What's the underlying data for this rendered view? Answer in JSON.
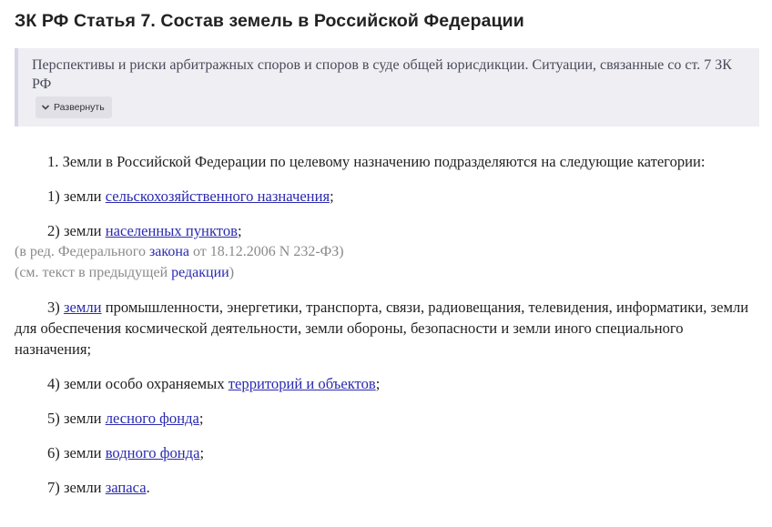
{
  "title": "ЗК РФ Статья 7. Состав земель в Российской Федерации",
  "related": {
    "text": "Перспективы и риски арбитражных споров и споров в суде общей юрисдикции. Ситуации, связанные со ст. 7 ЗК РФ",
    "expand_label": "Развернуть"
  },
  "article": {
    "intro": "1. Земли в Российской Федерации по целевому назначению подразделяются на следующие категории:",
    "item1_pre": "1) земли ",
    "item1_link": "сельскохозяйственного назначения",
    "item1_post": ";",
    "item2_pre": "2) земли ",
    "item2_link": "населенных пунктов",
    "item2_post": ";",
    "note1_pre": "(в ред. Федерального ",
    "note1_link": "закона",
    "note1_post": " от 18.12.2006 N 232-ФЗ)",
    "note2_pre": "(см. текст в предыдущей ",
    "note2_link": "редакции",
    "note2_post": ")",
    "item3_pre": "3) ",
    "item3_link": "земли",
    "item3_post": " промышленности, энергетики, транспорта, связи, радиовещания, телевидения, информатики, земли для обеспечения космической деятельности, земли обороны, безопасности и земли иного специального назначения;",
    "item4_pre": "4) земли особо охраняемых ",
    "item4_link": "территорий и объектов",
    "item4_post": ";",
    "item5_pre": "5) земли ",
    "item5_link": "лесного фонда",
    "item5_post": ";",
    "item6_pre": "6) земли ",
    "item6_link": "водного фонда",
    "item6_post": ";",
    "item7_pre": "7) земли ",
    "item7_link": "запаса",
    "item7_post": "."
  },
  "icons": {
    "expand": "chevron-down-icon"
  }
}
